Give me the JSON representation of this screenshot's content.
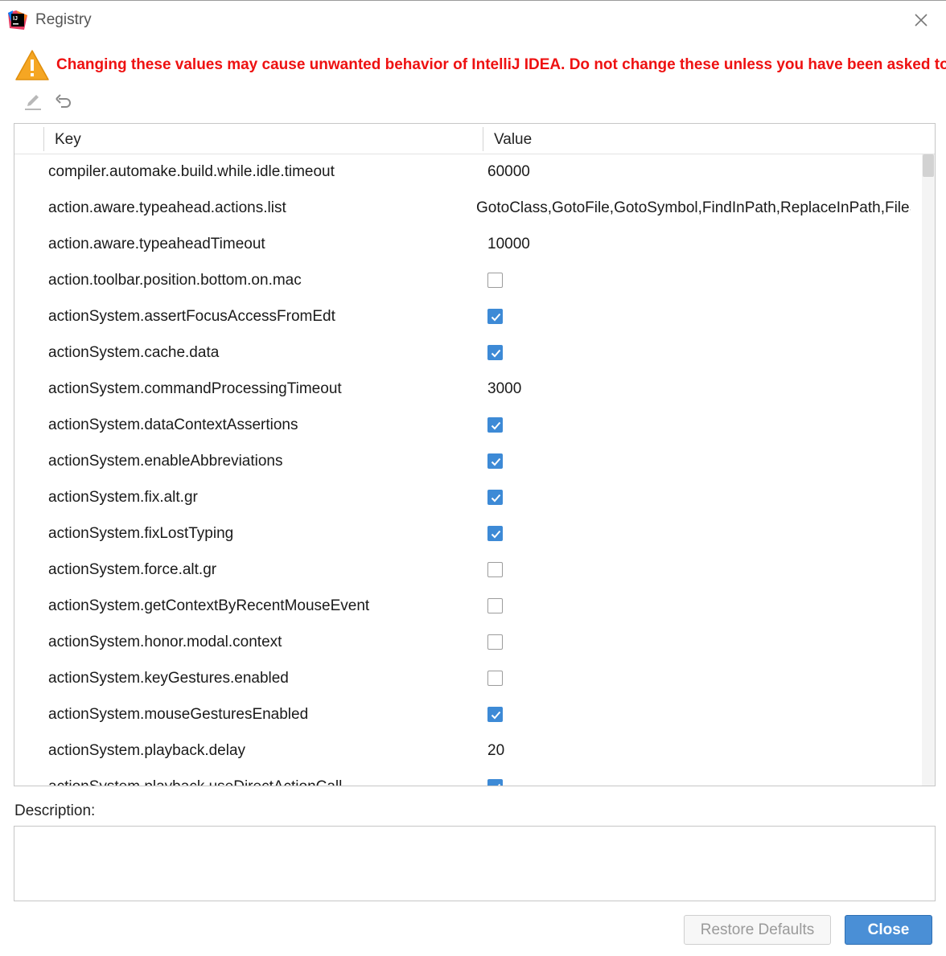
{
  "window": {
    "title": "Registry",
    "app_icon": "intellij-idea-icon",
    "close_icon": "close-icon"
  },
  "warning": {
    "icon": "warning-triangle-icon",
    "text": "Changing these values may cause unwanted behavior of IntelliJ IDEA. Do not change these unless you have been asked to.",
    "color": "#ee1111"
  },
  "toolbar": {
    "edit_icon": "pencil-edit-icon",
    "revert_icon": "undo-icon"
  },
  "table": {
    "columns": [
      "Key",
      "Value"
    ],
    "rows": [
      {
        "key": "compiler.automake.build.while.idle.timeout",
        "type": "text",
        "value": "60000"
      },
      {
        "key": "action.aware.typeahead.actions.list",
        "type": "text",
        "value": "GotoClass,GotoFile,GotoSymbol,FindInPath,ReplaceInPath,FileS"
      },
      {
        "key": "action.aware.typeaheadTimeout",
        "type": "text",
        "value": "10000"
      },
      {
        "key": "action.toolbar.position.bottom.on.mac",
        "type": "bool",
        "value": false
      },
      {
        "key": "actionSystem.assertFocusAccessFromEdt",
        "type": "bool",
        "value": true
      },
      {
        "key": "actionSystem.cache.data",
        "type": "bool",
        "value": true
      },
      {
        "key": "actionSystem.commandProcessingTimeout",
        "type": "text",
        "value": "3000"
      },
      {
        "key": "actionSystem.dataContextAssertions",
        "type": "bool",
        "value": true
      },
      {
        "key": "actionSystem.enableAbbreviations",
        "type": "bool",
        "value": true
      },
      {
        "key": "actionSystem.fix.alt.gr",
        "type": "bool",
        "value": true
      },
      {
        "key": "actionSystem.fixLostTyping",
        "type": "bool",
        "value": true
      },
      {
        "key": "actionSystem.force.alt.gr",
        "type": "bool",
        "value": false
      },
      {
        "key": "actionSystem.getContextByRecentMouseEvent",
        "type": "bool",
        "value": false
      },
      {
        "key": "actionSystem.honor.modal.context",
        "type": "bool",
        "value": false
      },
      {
        "key": "actionSystem.keyGestures.enabled",
        "type": "bool",
        "value": false
      },
      {
        "key": "actionSystem.mouseGesturesEnabled",
        "type": "bool",
        "value": true
      },
      {
        "key": "actionSystem.playback.delay",
        "type": "text",
        "value": "20"
      },
      {
        "key": "actionSystem.playback.useDirectActionCall",
        "type": "bool",
        "value": true
      }
    ]
  },
  "description": {
    "label": "Description:",
    "value": ""
  },
  "buttons": {
    "restore_defaults": "Restore Defaults",
    "close": "Close"
  },
  "colors": {
    "accent": "#4a8fd6",
    "checkbox_checked": "#3d8ad6"
  }
}
